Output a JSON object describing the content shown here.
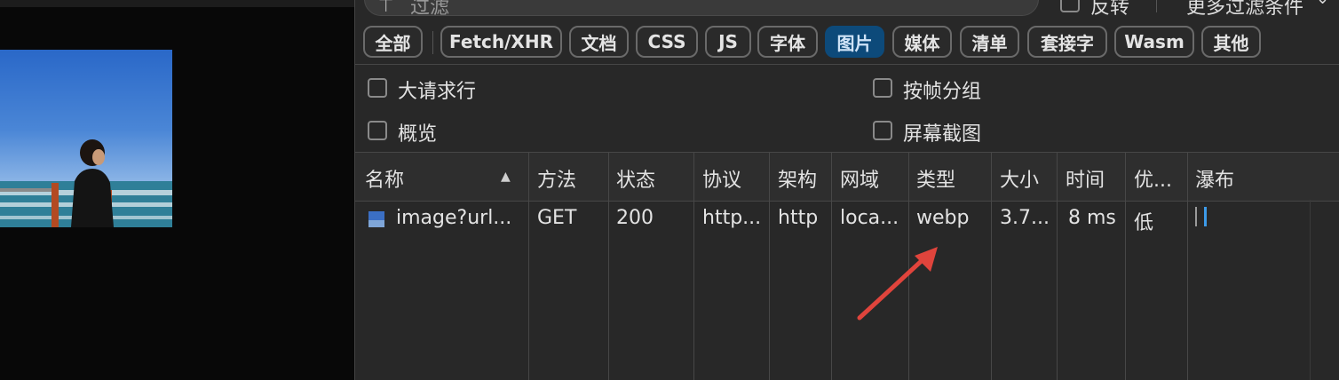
{
  "filter": {
    "placeholder": "过滤",
    "invert_label": "反转",
    "more_filters_label": "更多过滤条件"
  },
  "type_filters": [
    {
      "label": "全部"
    },
    {
      "label": "Fetch/XHR"
    },
    {
      "label": "文档"
    },
    {
      "label": "CSS"
    },
    {
      "label": "JS"
    },
    {
      "label": "字体"
    },
    {
      "label": "图片",
      "active": true
    },
    {
      "label": "媒体"
    },
    {
      "label": "清单"
    },
    {
      "label": "套接字"
    },
    {
      "label": "Wasm"
    },
    {
      "label": "其他"
    }
  ],
  "options": {
    "large_rows": "大请求行",
    "group_by_frame": "按帧分组",
    "overview": "概览",
    "screenshots": "屏幕截图"
  },
  "table": {
    "columns": [
      "名称",
      "方法",
      "状态",
      "协议",
      "架构",
      "网域",
      "类型",
      "大小",
      "时间",
      "优...",
      "瀑布"
    ],
    "rows": [
      {
        "name": "image?url...",
        "method": "GET",
        "status": "200",
        "protocol": "http...",
        "scheme": "http",
        "domain": "loca...",
        "type": "webp",
        "size": "3.7...",
        "time": "8 ms",
        "priority": "低"
      }
    ]
  },
  "colors": {
    "active_chip": "#0d4a7a",
    "annotation_arrow": "#e0443c",
    "waterfall_bar": "#3d9be9"
  }
}
